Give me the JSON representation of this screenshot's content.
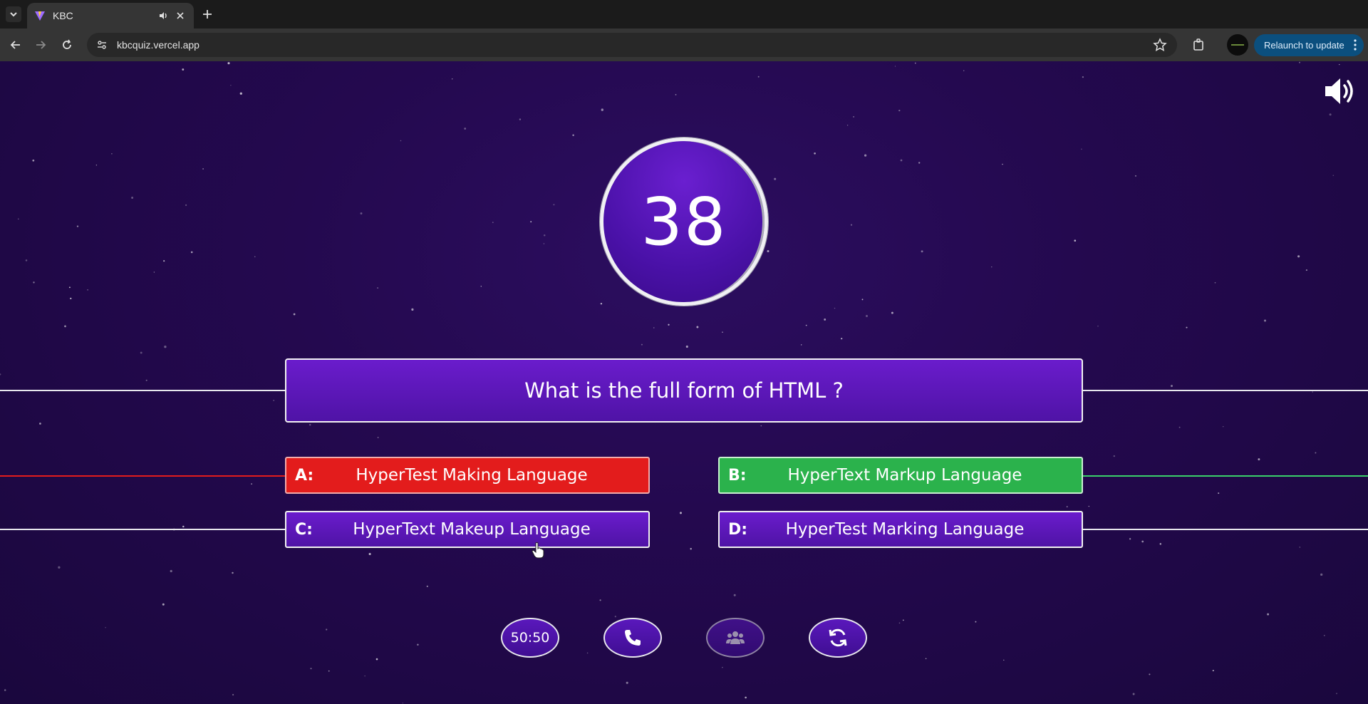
{
  "browser": {
    "tab_title": "KBC",
    "url": "kbcquiz.vercel.app",
    "relaunch_label": "Relaunch to update"
  },
  "game": {
    "timer": "38",
    "question": "What is the full form of HTML ?",
    "options": [
      {
        "letter": "A:",
        "text": "HyperTest Making Language",
        "state": "wrong"
      },
      {
        "letter": "B:",
        "text": "HyperText Markup Language",
        "state": "correct"
      },
      {
        "letter": "C:",
        "text": "HyperText Makeup Language",
        "state": "normal"
      },
      {
        "letter": "D:",
        "text": "HyperTest Marking Language",
        "state": "normal"
      }
    ],
    "lifelines": [
      {
        "label": "50:50",
        "icon": "text",
        "used": false
      },
      {
        "label": "",
        "icon": "phone-icon",
        "used": false
      },
      {
        "label": "",
        "icon": "audience-icon",
        "used": true
      },
      {
        "label": "",
        "icon": "swap-icon",
        "used": false
      }
    ]
  },
  "colors": {
    "wrong": "#e31c1c",
    "correct": "#2bb24c",
    "option_normal": "#5a16b6",
    "background": "#24094f"
  }
}
